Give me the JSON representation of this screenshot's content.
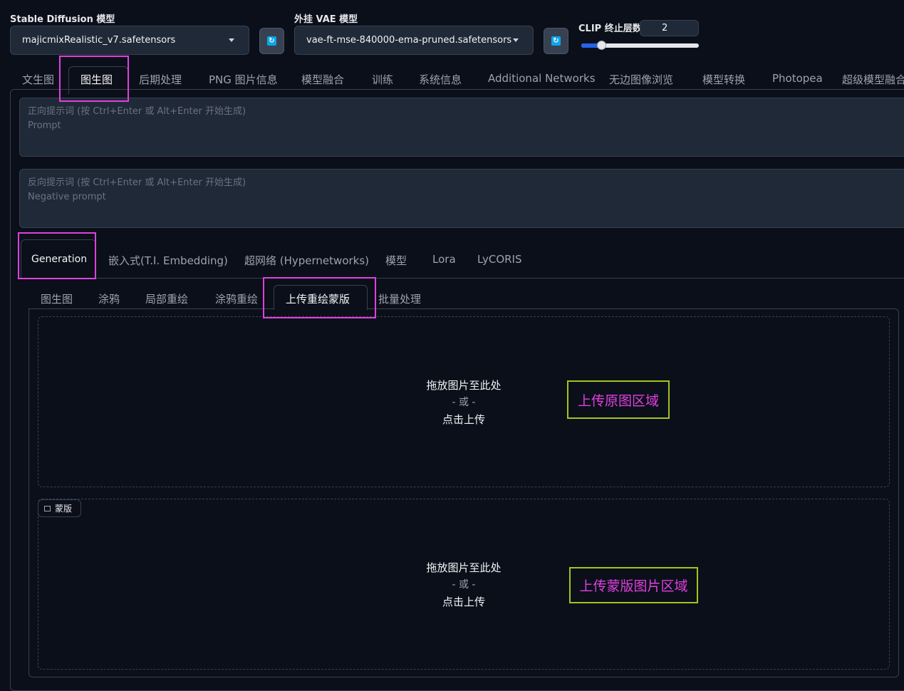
{
  "header": {
    "sd_model_label": "Stable Diffusion 模型",
    "sd_model_value": "majicmixRealistic_v7.safetensors",
    "vae_label": "外挂 VAE 模型",
    "vae_value": "vae-ft-mse-840000-ema-pruned.safetensors",
    "clip_label": "CLIP 终止层数",
    "clip_value": "2",
    "clip_slider": {
      "value": 2,
      "min": 1,
      "max": 12
    },
    "refresh_icon": "refresh-icon"
  },
  "main_tabs": [
    "文生图",
    "图生图",
    "后期处理",
    "PNG 图片信息",
    "模型融合",
    "训练",
    "系统信息",
    "Additional Networks",
    "无边图像浏览",
    "模型转换",
    "Photopea",
    "超级模型融合"
  ],
  "prompt": {
    "positive_hint": "正向提示词 (按 Ctrl+Enter 或 Alt+Enter 开始生成)",
    "positive_placeholder": "Prompt",
    "negative_hint": "反向提示词 (按 Ctrl+Enter 或 Alt+Enter 开始生成)",
    "negative_placeholder": "Negative prompt"
  },
  "sub_tabs": [
    "Generation",
    "嵌入式(T.I. Embedding)",
    "超网络 (Hypernetworks)",
    "模型",
    "Lora",
    "LyCORIS"
  ],
  "mode_tabs": [
    "图生图",
    "涂鸦",
    "局部重绘",
    "涂鸦重绘",
    "上传重绘蒙版",
    "批量处理"
  ],
  "upload": {
    "drop_text": "拖放图片至此处",
    "or_text": "- 或 -",
    "click_text": "点击上传",
    "mask_label": "蒙版"
  },
  "annotations": {
    "original_area": "上传原图区域",
    "mask_area": "上传蒙版图片区域"
  },
  "colors": {
    "highlight_pink": "#e040e0",
    "highlight_green": "#a3c31e",
    "accent": "#2563eb"
  }
}
